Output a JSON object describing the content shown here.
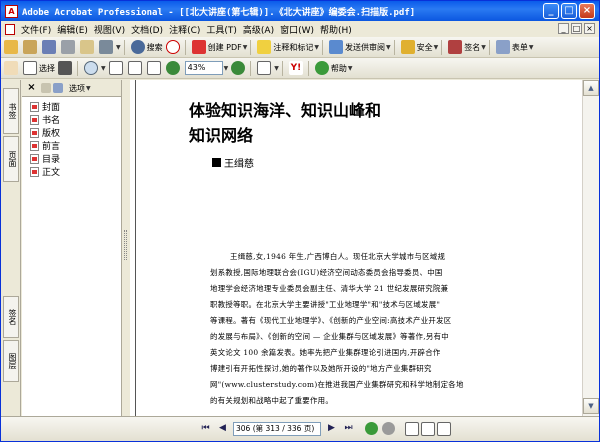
{
  "window": {
    "title": "Adobe Acrobat Professional - [[北大讲座(第七辑)].《北大讲座》编委会.扫描版.pdf]",
    "controls": {
      "minimize": "_",
      "maximize": "□",
      "close": "×"
    }
  },
  "menu": [
    "文件(F)",
    "编辑(E)",
    "视图(V)",
    "文档(D)",
    "注释(C)",
    "工具(T)",
    "高级(A)",
    "窗口(W)",
    "帮助(H)"
  ],
  "toolbar1": {
    "search_label": "搜索",
    "create_pdf": "创建 PDF",
    "comment_mark": "注释和标记",
    "send_review": "发送供审阅",
    "security": "安全",
    "sign": "签名",
    "forms": "表单"
  },
  "toolbar2": {
    "select_label": "选择",
    "zoom_value": "43%",
    "help_label": "帮助"
  },
  "left_tabs": [
    "书签",
    "页面",
    "签名",
    "图层"
  ],
  "panel": {
    "options_label": "选项",
    "close": "×"
  },
  "bookmarks": [
    "封面",
    "书名",
    "版权",
    "前言",
    "目录",
    "正文"
  ],
  "document": {
    "title_line1": "体验知识海洋、知识山峰和",
    "title_line2": "知识网络",
    "author": "王缉慈",
    "body": [
      "王缉慈,女,1946 年生,广西博白人。现任北京大学城市与区域规",
      "划系教授,国际地理联合会(IGU)经济空间动态委员会指导委员、中国",
      "地理学会经济地理专业委员会副主任、清华大学 21 世纪发展研究院兼",
      "职教授等职。在北京大学主要讲授\"工业地理学\"和\"技术与区域发展\"",
      "等课程。著有《现代工业地理学》、《创新的产业空间:高技术产业开发区",
      "的发展与布局》、《创新的空间 — 企业集群与区域发展》等著作,另有中",
      "英文论文 100 余篇发表。她率先把产业集群理论引进国内,开辟合作",
      "博建引有开拓性探讨,她的著作以及她所开设的\"地方产业集群研究",
      "网\"(www.clusterstudy.com)在推进我国产业集群研究和科学地制定各地",
      "的有关规划和战略中起了重要作用。"
    ]
  },
  "statusbar": {
    "page_display": "306 (第 313 / 336 页)"
  },
  "colors": {
    "titlebar": "#0a5bea",
    "chrome": "#ece9d8",
    "acrobat_red": "#cc0000"
  }
}
